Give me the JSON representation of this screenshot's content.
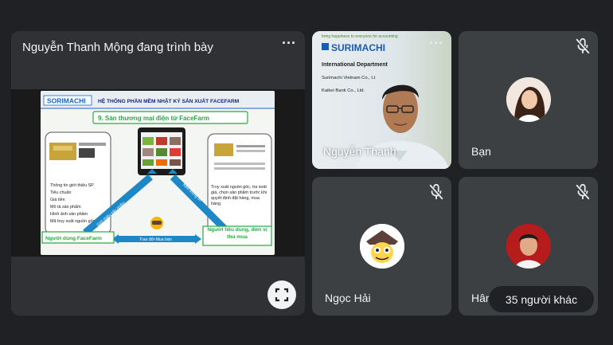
{
  "presentation": {
    "title": "Nguyễn Thanh Mộng đang trình bày",
    "slide": {
      "logo": "SORIMACHI",
      "heading": "HỆ THỐNG PHẦN MỀM NHẬT KÝ SẢN XUẤT FACEFARM",
      "subheading": "9. Sàn thương mại điện tử FaceFarm",
      "left_list": [
        "Thông tin giới thiệu SP",
        "Tiêu chuẩn",
        "Giá tiền",
        "Mô tả sản phẩm",
        "Hình ảnh sản phẩm",
        "Mã truy xuất nguồn gốc"
      ],
      "right_text": "Truy xuất nguồn gốc, tra soát giá, chọn sản phẩm trước khi quyết định đặt hàng, mua hàng",
      "left_label": "Người dùng FaceFarm",
      "right_label": "Người tiêu dùng, đơn vị thu mua",
      "bottom_label": "Trao đổi-Mua bán",
      "arrow_left": "Giới thiệu sản phẩm",
      "arrow_right": "Xem thông tin"
    }
  },
  "participants": {
    "camera": {
      "name": "Nguyễn Thanh",
      "banner_top": "bring happiness to everyone for accounting",
      "banner_brand": "SURIMACHI",
      "banner_dept": "International Department",
      "banner_line1": "Surimachi Vietnam Co., Lt",
      "banner_line2": "Kaikei Bank Co., Ltd."
    },
    "ban": {
      "name": "Bạn"
    },
    "ngoc_hai": {
      "name": "Ngọc Hải"
    },
    "han": {
      "name": "Hân"
    }
  },
  "others": {
    "label": "35 người khác"
  },
  "icons": {
    "menu": "more-vert-icon",
    "mic_off": "mic-off-icon",
    "fullscreen": "fullscreen-icon"
  },
  "colors": {
    "background": "#202124",
    "tile": "#3c4043",
    "accent": "#1e88c7",
    "slide_green": "#27a845"
  }
}
